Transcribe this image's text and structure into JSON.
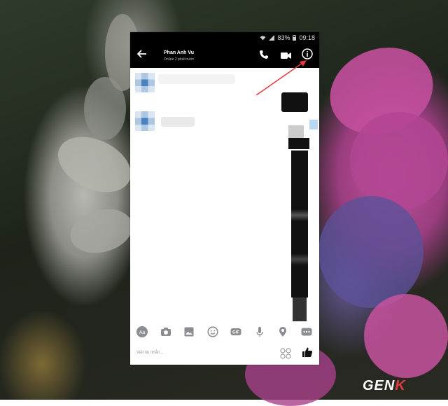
{
  "status_bar": {
    "battery": "83%",
    "time": "09:18"
  },
  "header": {
    "contact_name": "Phan Anh Vu",
    "contact_status": "Online 2 phút trước"
  },
  "composer": {
    "placeholder": "Viết tin nhắn..."
  },
  "watermark": {
    "text_prefix": "GEN",
    "text_suffix": "K"
  },
  "colors": {
    "appbar": "#000000",
    "accent": "#0084ff",
    "annotation_arrow": "#e23b3b"
  },
  "icons": [
    "back-arrow-icon",
    "phone-icon",
    "video-camera-icon",
    "info-icon",
    "text-format-icon",
    "camera-icon",
    "gallery-icon",
    "emoji-icon",
    "gif-icon",
    "microphone-icon",
    "location-icon",
    "more-icon",
    "dice-icon",
    "thumbs-up-icon"
  ]
}
